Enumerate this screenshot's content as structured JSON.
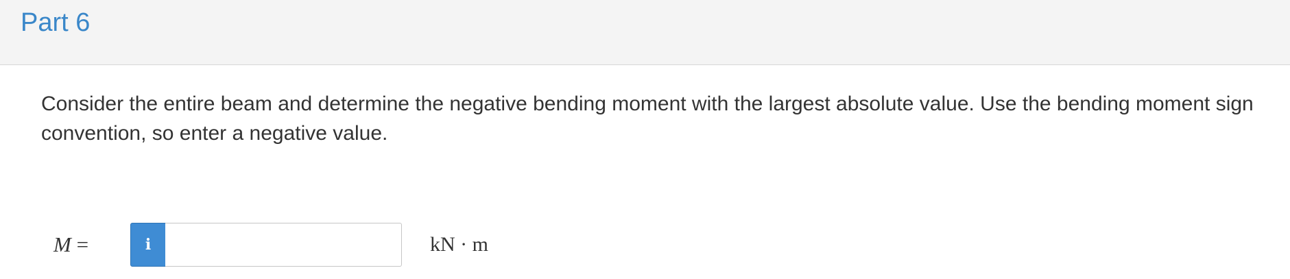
{
  "header": {
    "part_title": "Part 6"
  },
  "question": {
    "text": "Consider the entire beam and determine the negative bending moment with the largest absolute value.  Use the bending moment sign convention, so enter a negative value."
  },
  "answer": {
    "variable": "M",
    "equals": "=",
    "info_icon": "i",
    "input_value": "",
    "unit": "kN · m"
  },
  "colors": {
    "header_bg": "#f4f4f4",
    "title": "#3a87c9",
    "info_button": "#3f8cd4",
    "text": "#333333"
  },
  "icons": {
    "info": "info-icon"
  }
}
